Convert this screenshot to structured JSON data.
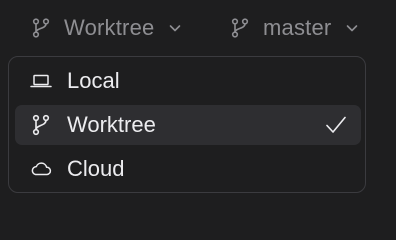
{
  "toolbar": {
    "environment": {
      "label": "Worktree",
      "icon": "branch-icon"
    },
    "branch": {
      "label": "master",
      "icon": "branch-icon"
    }
  },
  "menu": {
    "items": [
      {
        "label": "Local",
        "icon": "laptop-icon",
        "selected": false
      },
      {
        "label": "Worktree",
        "icon": "branch-icon",
        "selected": true
      },
      {
        "label": "Cloud",
        "icon": "cloud-icon",
        "selected": false
      }
    ]
  },
  "colors": {
    "background": "#1e1e1f",
    "toolbar_text": "#8e8e92",
    "menu_text": "#ececef",
    "menu_border": "#3b3b3f",
    "selected_bg": "#2e2e31"
  }
}
